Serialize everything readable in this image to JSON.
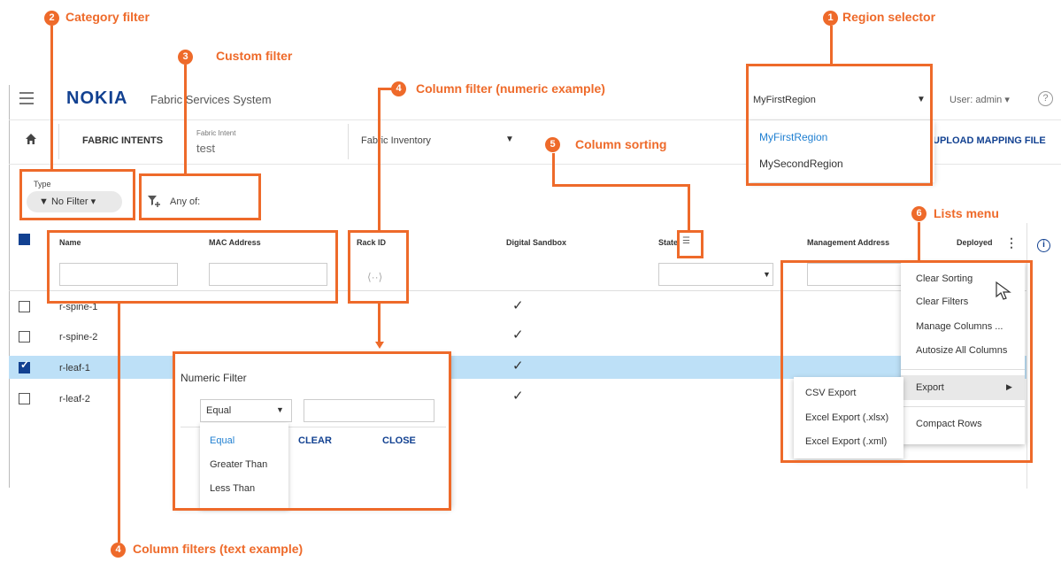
{
  "app": {
    "brand": "NOKIA",
    "title": "Fabric Services System",
    "user": "User: admin",
    "help": "?"
  },
  "nav": {
    "fabric_intents": "FABRIC INTENTS",
    "intent_label": "Fabric Intent",
    "intent_value": "test",
    "inventory": "Fabric Inventory",
    "upload": "UPLOAD MAPPING FILE"
  },
  "region": {
    "selected": "MyFirstRegion",
    "options": [
      "MyFirstRegion",
      "MySecondRegion"
    ]
  },
  "filters": {
    "type_label": "Type",
    "type_value": "No Filter",
    "custom": "Any of:"
  },
  "table": {
    "columns": [
      "Name",
      "MAC Address",
      "Rack ID",
      "Digital Sandbox",
      "State",
      "Management Address",
      "Deployed"
    ],
    "rows": [
      {
        "name": "r-spine-1",
        "sandbox": "✓",
        "selected": false
      },
      {
        "name": "r-spine-2",
        "sandbox": "✓",
        "selected": false
      },
      {
        "name": "r-leaf-1",
        "sandbox": "✓",
        "selected": true
      },
      {
        "name": "r-leaf-2",
        "sandbox": "✓",
        "selected": false
      }
    ]
  },
  "numeric_filter": {
    "title": "Numeric Filter",
    "selected": "Equal",
    "options": [
      "Equal",
      "Greater Than",
      "Less Than"
    ],
    "clear": "CLEAR",
    "close": "CLOSE"
  },
  "lists_menu": {
    "items": [
      "Clear Sorting",
      "Clear Filters",
      "Manage Columns ...",
      "Autosize All Columns",
      "Export",
      "Compact Rows"
    ],
    "export_items": [
      "CSV Export",
      "Excel Export (.xlsx)",
      "Excel Export (.xml)"
    ]
  },
  "annotations": {
    "a1": {
      "num": "1",
      "text": "Region selector"
    },
    "a2": {
      "num": "2",
      "text": "Category filter"
    },
    "a3": {
      "num": "3",
      "text": "Custom filter"
    },
    "a4a": {
      "num": "4",
      "text": "Column filter (numeric example)"
    },
    "a4b": {
      "num": "4",
      "text": "Column filters (text example)"
    },
    "a5": {
      "num": "5",
      "text": "Column sorting"
    },
    "a6": {
      "num": "6",
      "text": "Lists menu"
    }
  },
  "colors": {
    "accent": "#ee6a2a",
    "brand": "#124191",
    "selection": "#bde0f7"
  },
  "icons": [
    "hamburger-icon",
    "home-icon",
    "filter-icon",
    "add-filter-icon",
    "info-icon",
    "kebab-icon",
    "sort-icon",
    "cursor-icon"
  ]
}
